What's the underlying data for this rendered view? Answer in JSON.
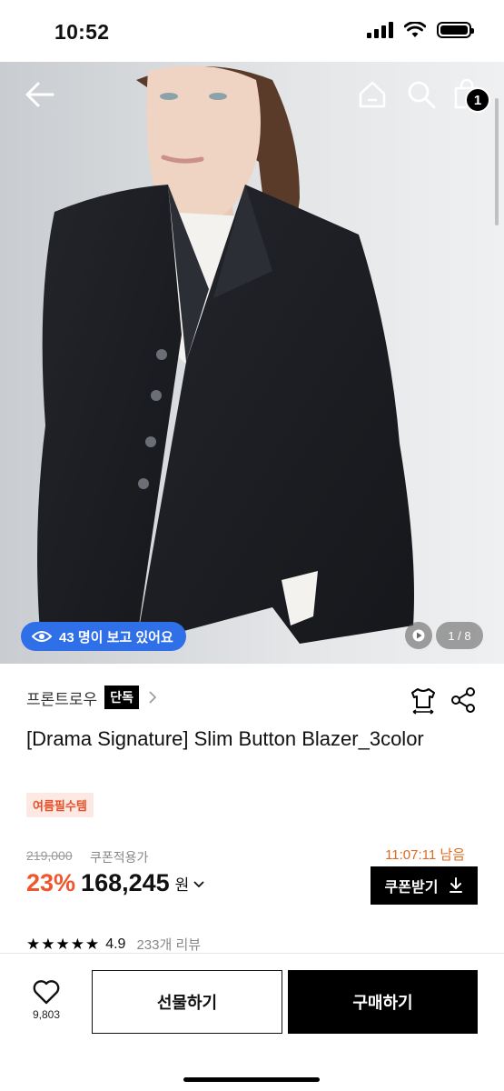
{
  "status_bar": {
    "time": "10:52"
  },
  "header": {
    "cart_count": "1"
  },
  "gallery": {
    "viewers_text": "43 명이 보고 있어요",
    "page_indicator": "1 / 8"
  },
  "product": {
    "brand": "프론트로우",
    "exclusive_badge": "단독",
    "title": "[Drama Signature] Slim Button Blazer_3color",
    "tag": "여름필수템",
    "original_price": "219,000",
    "coupon_price_label": "쿠폰적용가",
    "countdown": "11:07:11 남음",
    "discount": "23%",
    "sale_price": "168,245",
    "currency": "원",
    "coupon_button": "쿠폰받기",
    "rating": "4.9",
    "stars": "★★★★★",
    "review_count": "233개 리뷰"
  },
  "bottom_bar": {
    "like_count": "9,803",
    "gift_label": "선물하기",
    "buy_label": "구매하기"
  },
  "icons": [
    "back-arrow-icon",
    "home-icon",
    "search-icon",
    "shopping-bag-icon",
    "eye-icon",
    "play-icon",
    "chevron-right-icon",
    "fit-size-icon",
    "share-icon",
    "download-icon",
    "heart-icon"
  ],
  "colors": {
    "viewers_pill": "#2f6fe8",
    "discount": "#f0552b",
    "countdown": "#e06b1c",
    "tag_bg": "#fde9e4",
    "tag_text": "#e8502a"
  }
}
